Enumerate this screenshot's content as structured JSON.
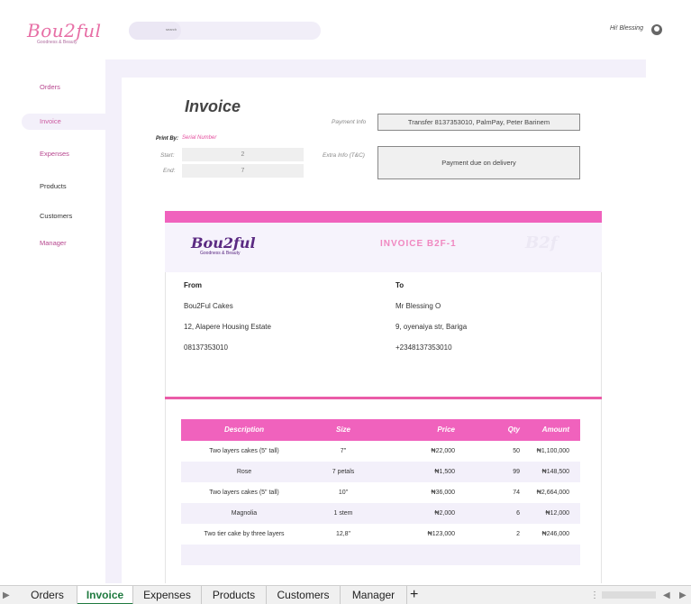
{
  "brand": {
    "logo_main": "Bou2ful",
    "logo_sub": "Goodness & Beauty"
  },
  "search": {
    "placeholder": "search"
  },
  "header": {
    "greeting": "Hi! Blessing"
  },
  "sidebar": {
    "items": [
      {
        "label": "Orders"
      },
      {
        "label": "Invoice"
      },
      {
        "label": "Expenses"
      },
      {
        "label": "Products"
      },
      {
        "label": "Customers"
      },
      {
        "label": "Manager"
      }
    ]
  },
  "form": {
    "title": "Invoice",
    "print_by_label": "Print By:",
    "print_by_value": "Serial Number",
    "start_label": "Start:",
    "start_value": "2",
    "end_label": "End:",
    "end_value": "7",
    "payment_label": "Payment Info",
    "payment_value": "Transfer 8137353010, PalmPay, Peter Barinem",
    "extra_label": "Extra Info (T&C)",
    "extra_value": "Payment due on delivery"
  },
  "invoice": {
    "number": "INVOICE B2F-1",
    "watermark": "B2f",
    "from": {
      "heading": "From",
      "name": "Bou2Ful Cakes",
      "address": "12, Alapere Housing Estate",
      "phone": "08137353010"
    },
    "to": {
      "heading": "To",
      "name": "Mr Blessing O",
      "address": "9, oyenaiya str, Bariga",
      "phone": "+2348137353010"
    },
    "columns": [
      "Description",
      "Size",
      "Price",
      "Qty",
      "Amount"
    ],
    "rows": [
      [
        "Two layers cakes (5\" tall)",
        "7\"",
        "₦22,000",
        "50",
        "₦1,100,000"
      ],
      [
        "Rose",
        "7 petals",
        "₦1,500",
        "99",
        "₦148,500"
      ],
      [
        "Two layers cakes (5\" tall)",
        "10\"",
        "₦36,000",
        "74",
        "₦2,664,000"
      ],
      [
        "Magnolia",
        "1 stem",
        "₦2,000",
        "6",
        "₦12,000"
      ],
      [
        "Two tier cake by three layers",
        "12,8\"",
        "₦123,000",
        "2",
        "₦246,000"
      ]
    ]
  },
  "sheet_tabs": [
    "Orders",
    "Invoice",
    "Expenses",
    "Products",
    "Customers",
    "Manager"
  ],
  "colors": {
    "accent": "#f062bd",
    "panel": "#f3f0fa",
    "active_tab": "#1f7a3f"
  }
}
